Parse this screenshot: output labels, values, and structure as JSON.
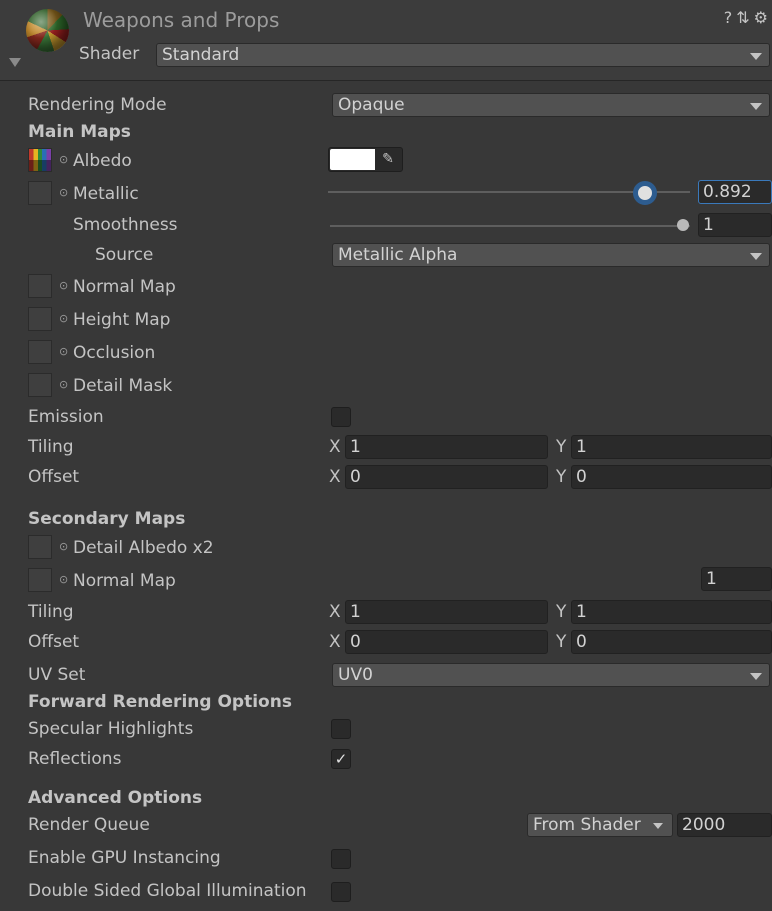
{
  "header": {
    "title": "Weapons and Props",
    "icons": "? ⇅ ⚙",
    "shader_label": "Shader",
    "shader_value": "Standard"
  },
  "rendering_mode": {
    "label": "Rendering Mode",
    "value": "Opaque"
  },
  "main_maps": {
    "title": "Main Maps",
    "albedo": "Albedo",
    "albedo_color": "#ffffff",
    "metallic": "Metallic",
    "metallic_value": "0.892",
    "smoothness": "Smoothness",
    "smoothness_value": "1",
    "source_label": "Source",
    "source_value": "Metallic Alpha",
    "normal_map": "Normal Map",
    "height_map": "Height Map",
    "occlusion": "Occlusion",
    "detail_mask": "Detail Mask",
    "emission": "Emission",
    "tiling": "Tiling",
    "tiling_x": "1",
    "tiling_y": "1",
    "offset": "Offset",
    "offset_x": "0",
    "offset_y": "0"
  },
  "secondary_maps": {
    "title": "Secondary Maps",
    "detail_albedo": "Detail Albedo x2",
    "normal_map": "Normal Map",
    "normal_scale": "1",
    "tiling": "Tiling",
    "tiling_x": "1",
    "tiling_y": "1",
    "offset": "Offset",
    "offset_x": "0",
    "offset_y": "0",
    "uv_set_label": "UV Set",
    "uv_set_value": "UV0"
  },
  "forward": {
    "title": "Forward Rendering Options",
    "specular": "Specular Highlights",
    "reflections": "Reflections"
  },
  "advanced": {
    "title": "Advanced Options",
    "render_queue": "Render Queue",
    "render_queue_mode": "From Shader",
    "render_queue_value": "2000",
    "gpu_instancing": "Enable GPU Instancing",
    "double_sided_gi": "Double Sided Global Illumination"
  },
  "axis": {
    "x": "X",
    "y": "Y"
  },
  "check_mark": "✓"
}
